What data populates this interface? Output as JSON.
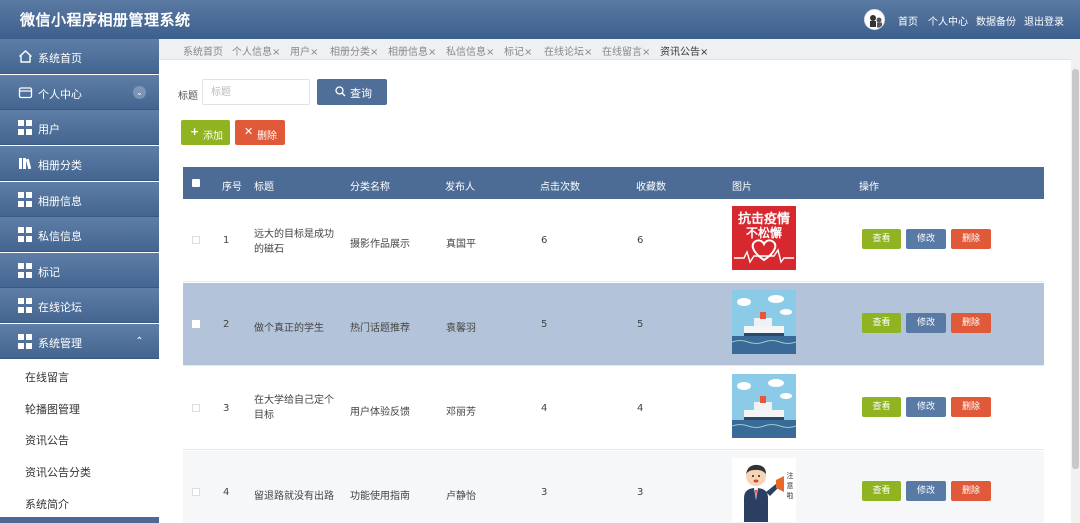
{
  "app": {
    "title": "微信小程序相册管理系统"
  },
  "header_nav": [
    "首页",
    "个人中心",
    "数据备份",
    "退出登录"
  ],
  "sidebar": {
    "items": [
      {
        "label": "系统首页",
        "icon": "home-icon"
      },
      {
        "label": "个人中心",
        "icon": "wallet-icon",
        "expandable": true,
        "state": "collapsed"
      },
      {
        "label": "用户",
        "icon": "grid-icon"
      },
      {
        "label": "相册分类",
        "icon": "books-icon"
      },
      {
        "label": "相册信息",
        "icon": "grid-icon"
      },
      {
        "label": "私信信息",
        "icon": "grid-icon"
      },
      {
        "label": "标记",
        "icon": "grid-icon"
      },
      {
        "label": "在线论坛",
        "icon": "grid-icon"
      },
      {
        "label": "系统管理",
        "icon": "grid-icon",
        "expandable": true,
        "state": "expanded"
      }
    ],
    "subitems": [
      "在线留言",
      "轮播图管理",
      "资讯公告",
      "资讯公告分类",
      "系统简介"
    ]
  },
  "tabs": [
    {
      "label": "系统首页"
    },
    {
      "label": "个人信息×"
    },
    {
      "label": "用户×"
    },
    {
      "label": "相册分类×"
    },
    {
      "label": "相册信息×"
    },
    {
      "label": "私信信息×"
    },
    {
      "label": "标记×"
    },
    {
      "label": "在线论坛×"
    },
    {
      "label": "在线留言×"
    },
    {
      "label": "资讯公告×",
      "active": true
    }
  ],
  "search": {
    "label": "标题",
    "placeholder": "标题",
    "button": "查询"
  },
  "actions": {
    "add": "添加",
    "delete": "删除"
  },
  "table": {
    "headers": [
      "序号",
      "标题",
      "分类名称",
      "发布人",
      "点击次数",
      "收藏数",
      "图片",
      "操作"
    ],
    "rows": [
      {
        "no": "1",
        "title": "远大的目标是成功的磁石",
        "category": "摄影作品展示",
        "publisher": "真国平",
        "clicks": "6",
        "favorites": "6",
        "image": "poster-image",
        "poster_text": [
          "抗击疫情",
          "不松懈"
        ]
      },
      {
        "no": "2",
        "title": "做个真正的学生",
        "category": "热门话题推荐",
        "publisher": "袁馨羽",
        "clicks": "5",
        "favorites": "5",
        "image": "ship-image"
      },
      {
        "no": "3",
        "title": "在大学给自己定个目标",
        "category": "用户体验反馈",
        "publisher": "邓丽芳",
        "clicks": "4",
        "favorites": "4",
        "image": "ship-image"
      },
      {
        "no": "4",
        "title": "留退路就没有出路",
        "category": "功能使用指南",
        "publisher": "卢静怡",
        "clicks": "3",
        "favorites": "3",
        "image": "cartoon-image",
        "cartoon_text": [
          "注",
          "意",
          "啦"
        ]
      }
    ],
    "row_actions": {
      "view": "查看",
      "edit": "修改",
      "delete": "删除"
    }
  },
  "colors": {
    "header": "#4a6a94",
    "selected_row": "#b3c4da",
    "add": "#8fb321",
    "delete": "#e05a3a",
    "edit": "#5a7aa6"
  }
}
